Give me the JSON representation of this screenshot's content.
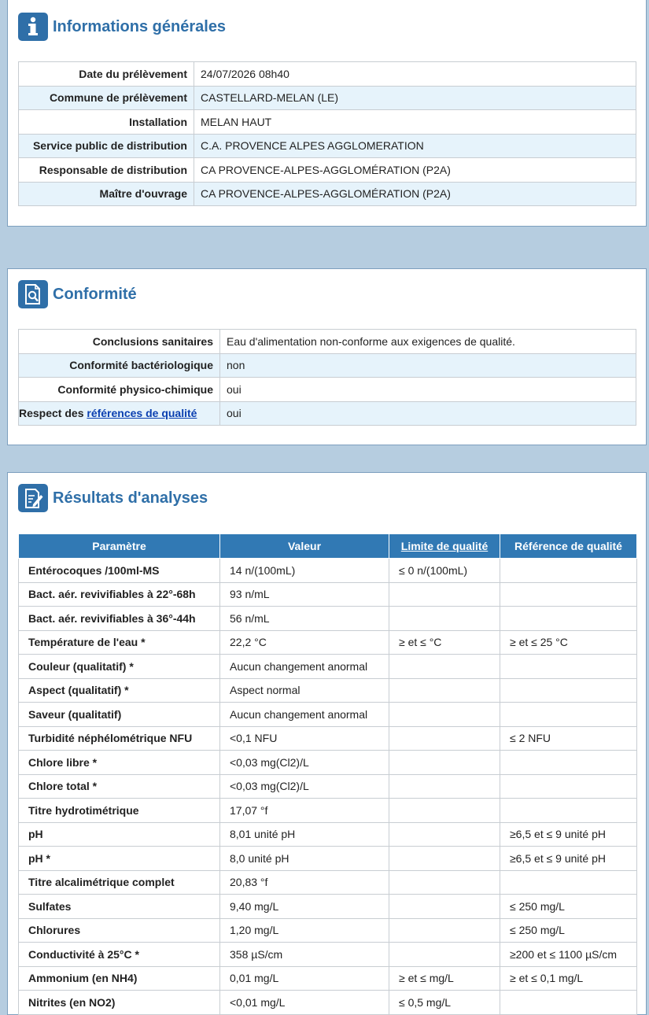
{
  "info": {
    "title": "Informations générales",
    "icon": "info-icon",
    "rows": [
      {
        "label": "Date du prélèvement",
        "value": "24/07/2026  08h40"
      },
      {
        "label": "Commune de prélèvement",
        "value": "CASTELLARD-MELAN (LE)"
      },
      {
        "label": "Installation",
        "value": "MELAN HAUT"
      },
      {
        "label": "Service public de distribution",
        "value": "C.A. PROVENCE ALPES AGGLOMERATION"
      },
      {
        "label": "Responsable de distribution",
        "value": "CA PROVENCE-ALPES-AGGLOMÉRATION (P2A)"
      },
      {
        "label": "Maître d'ouvrage",
        "value": "CA PROVENCE-ALPES-AGGLOMÉRATION (P2A)"
      }
    ]
  },
  "conformite": {
    "title": "Conformité",
    "icon": "document-search-icon",
    "rows": [
      {
        "label": "Conclusions sanitaires",
        "value": "Eau d'alimentation non-conforme aux exigences de qualité."
      },
      {
        "label": "Conformité bactériologique",
        "value": "non"
      },
      {
        "label": "Conformité physico-chimique",
        "value": "oui"
      }
    ],
    "respect_prefix": "Respect des ",
    "respect_link": "références de qualité",
    "respect_value": "oui"
  },
  "resultats": {
    "title": "Résultats d'analyses",
    "icon": "edit-document-icon",
    "headers": [
      "Paramètre",
      "Valeur",
      "Limite de qualité",
      "Référence de qualité"
    ],
    "rows": [
      {
        "param": "Entérocoques /100ml-MS",
        "value": "14 n/(100mL)",
        "limit": "≤ 0 n/(100mL)",
        "ref": ""
      },
      {
        "param": "Bact. aér. revivifiables à 22°-68h",
        "value": "93 n/mL",
        "limit": "",
        "ref": ""
      },
      {
        "param": "Bact. aér. revivifiables à 36°-44h",
        "value": "56 n/mL",
        "limit": "",
        "ref": ""
      },
      {
        "param": "Température de l'eau *",
        "value": "22,2 °C",
        "limit": "≥ et ≤ °C",
        "ref": "≥ et ≤ 25 °C"
      },
      {
        "param": "Couleur (qualitatif) *",
        "value": "Aucun changement anormal",
        "limit": "",
        "ref": ""
      },
      {
        "param": "Aspect (qualitatif) *",
        "value": "Aspect normal",
        "limit": "",
        "ref": ""
      },
      {
        "param": "Saveur (qualitatif)",
        "value": "Aucun changement anormal",
        "limit": "",
        "ref": ""
      },
      {
        "param": "Turbidité néphélométrique NFU",
        "value": "<0,1 NFU",
        "limit": "",
        "ref": "≤ 2 NFU"
      },
      {
        "param": "Chlore libre *",
        "value": "<0,03 mg(Cl2)/L",
        "limit": "",
        "ref": ""
      },
      {
        "param": "Chlore total *",
        "value": "<0,03 mg(Cl2)/L",
        "limit": "",
        "ref": ""
      },
      {
        "param": "Titre hydrotimétrique",
        "value": "17,07 °f",
        "limit": "",
        "ref": ""
      },
      {
        "param": "pH",
        "value": "8,01 unité pH",
        "limit": "",
        "ref": "≥6,5 et ≤ 9 unité pH"
      },
      {
        "param": "pH *",
        "value": "8,0 unité pH",
        "limit": "",
        "ref": "≥6,5 et ≤ 9 unité pH"
      },
      {
        "param": "Titre alcalimétrique complet",
        "value": "20,83 °f",
        "limit": "",
        "ref": ""
      },
      {
        "param": "Sulfates",
        "value": "9,40 mg/L",
        "limit": "",
        "ref": "≤ 250 mg/L"
      },
      {
        "param": "Chlorures",
        "value": "1,20 mg/L",
        "limit": "",
        "ref": "≤ 250 mg/L"
      },
      {
        "param": "Conductivité à 25°C *",
        "value": "358 µS/cm",
        "limit": "",
        "ref": "≥200 et ≤ 1100 µS/cm"
      },
      {
        "param": "Ammonium (en NH4)",
        "value": "0,01 mg/L",
        "limit": "≥ et ≤ mg/L",
        "ref": "≥ et ≤ 0,1 mg/L"
      },
      {
        "param": "Nitrites (en NO2)",
        "value": "<0,01 mg/L",
        "limit": "≤ 0,5 mg/L",
        "ref": ""
      }
    ]
  }
}
